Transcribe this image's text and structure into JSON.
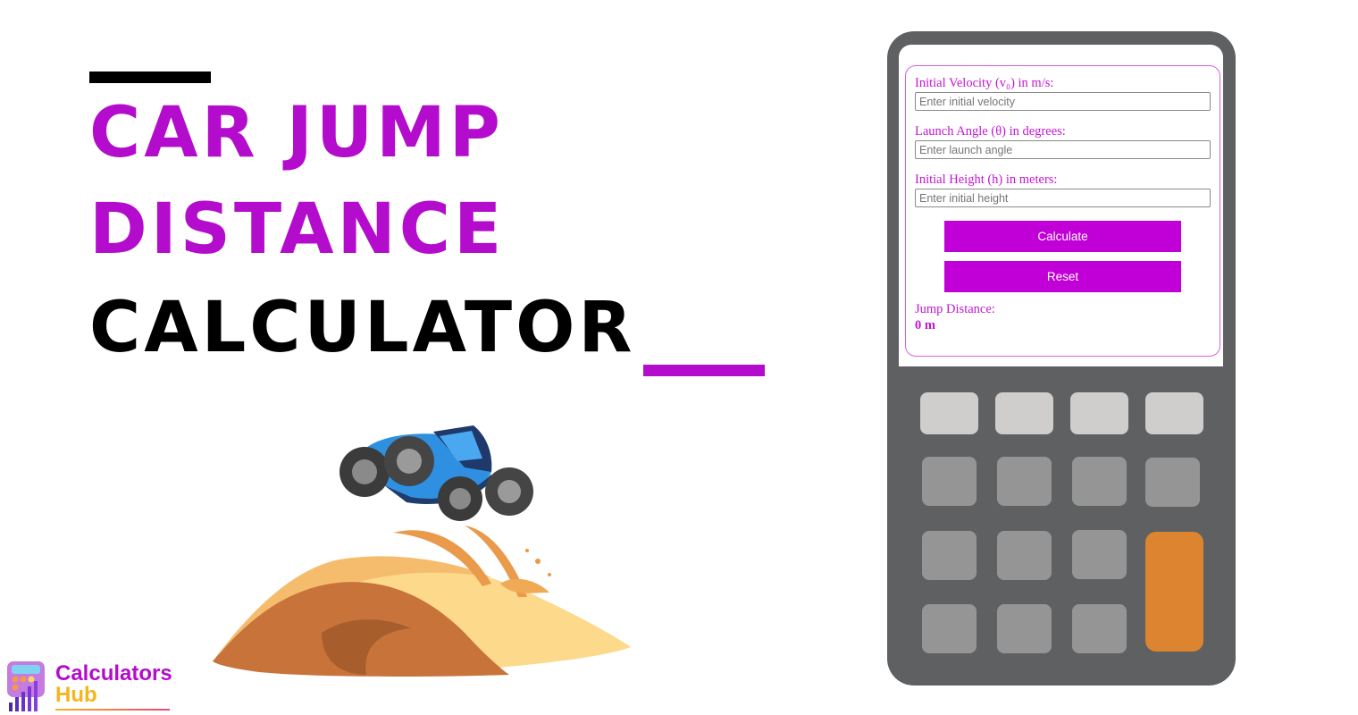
{
  "title": {
    "line1": "CAR JUMP",
    "line2": "DISTANCE",
    "line3": "CALCULATOR"
  },
  "colors": {
    "accent": "#b40ccc",
    "button": "#c000d6",
    "calculator_body": "#5f6062",
    "key_light": "#cfcecc",
    "key_mid": "#959595",
    "key_orange": "#dc8430"
  },
  "illustration": {
    "description": "blue off-road buggy jumping over sand dune"
  },
  "logo": {
    "word1": "Calculators",
    "word2": "Hub"
  },
  "form": {
    "fields": [
      {
        "label": "Initial Velocity (v₀) in m/s:",
        "placeholder": "Enter initial velocity",
        "value": ""
      },
      {
        "label": "Launch Angle (θ) in degrees:",
        "placeholder": "Enter launch angle",
        "value": ""
      },
      {
        "label": "Initial Height (h) in meters:",
        "placeholder": "Enter initial height",
        "value": ""
      }
    ],
    "calculate_label": "Calculate",
    "reset_label": "Reset",
    "result_label": "Jump Distance:",
    "result_value": "0 m"
  },
  "keypad": {
    "rows": [
      [
        "light",
        "light",
        "light",
        "light"
      ],
      [
        "mid",
        "mid",
        "mid",
        "mid"
      ],
      [
        "mid",
        "mid",
        "mid",
        "orange"
      ],
      [
        "mid",
        "mid",
        "mid"
      ]
    ]
  }
}
